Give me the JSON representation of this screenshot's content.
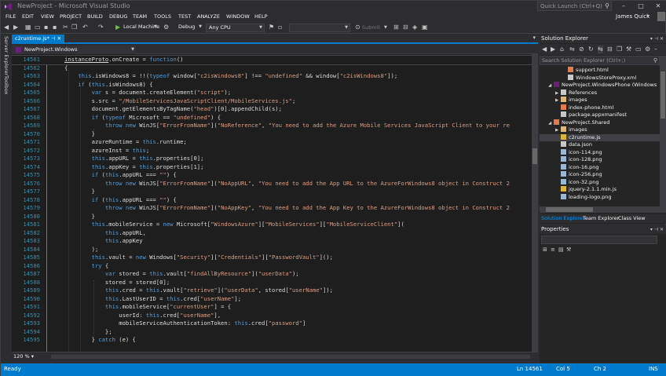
{
  "window": {
    "title": "NewProject - Microsoft Visual Studio"
  },
  "quick_launch": {
    "placeholder": "Quick Launch (Ctrl+Q)"
  },
  "user": {
    "name": "James Quick"
  },
  "menu": [
    "FILE",
    "EDIT",
    "VIEW",
    "PROJECT",
    "BUILD",
    "DEBUG",
    "TEAM",
    "TOOLS",
    "TEST",
    "ANALYZE",
    "WINDOW",
    "HELP"
  ],
  "toolbar": {
    "run_target": "Local Machine",
    "configuration": "Debug",
    "platform": "Any CPU",
    "submit_label": "Submit"
  },
  "left_rail": {
    "server_explorer": "Server Explorer",
    "toolbox": "Toolbox"
  },
  "editor": {
    "tab_label": "c2runtime.js*",
    "nav_scope": "NewProject.Windows",
    "zoom": "120 %",
    "lines": [
      {
        "num": "14561",
        "tokens": [
          {
            "t": "instanceProto",
            "c": "hl"
          },
          {
            "t": ".onCreate = ",
            "c": ""
          },
          {
            "t": "function",
            "c": "k"
          },
          {
            "t": "()",
            "c": ""
          }
        ]
      },
      {
        "num": "14562",
        "tokens": [
          {
            "t": "{",
            "c": ""
          }
        ]
      },
      {
        "num": "14563",
        "tokens": [
          {
            "t": "    ",
            "c": ""
          },
          {
            "t": "this",
            "c": "k"
          },
          {
            "t": ".isWindows8 = !!(",
            "c": ""
          },
          {
            "t": "typeof",
            "c": "k"
          },
          {
            "t": " window[",
            "c": ""
          },
          {
            "t": "\"c2isWindows8\"",
            "c": "s"
          },
          {
            "t": "] !== ",
            "c": ""
          },
          {
            "t": "\"undefined\"",
            "c": "s"
          },
          {
            "t": " && window[",
            "c": ""
          },
          {
            "t": "\"c2isWindows8\"",
            "c": "s"
          },
          {
            "t": "]);",
            "c": ""
          }
        ]
      },
      {
        "num": "14564",
        "tokens": [
          {
            "t": "    ",
            "c": ""
          },
          {
            "t": "if",
            "c": "k"
          },
          {
            "t": " (",
            "c": ""
          },
          {
            "t": "this",
            "c": "k"
          },
          {
            "t": ".isWindows8) {",
            "c": ""
          }
        ]
      },
      {
        "num": "14565",
        "tokens": [
          {
            "t": "        ",
            "c": ""
          },
          {
            "t": "var",
            "c": "k"
          },
          {
            "t": " s = document.createElement(",
            "c": ""
          },
          {
            "t": "\"script\"",
            "c": "s"
          },
          {
            "t": ");",
            "c": ""
          }
        ]
      },
      {
        "num": "14566",
        "tokens": [
          {
            "t": "        s.src = ",
            "c": ""
          },
          {
            "t": "\"/MobileServicesJavaScriptClient/MobileServices.js\"",
            "c": "s"
          },
          {
            "t": ";",
            "c": ""
          }
        ]
      },
      {
        "num": "14567",
        "tokens": [
          {
            "t": "        document.getElementsByTagName(",
            "c": ""
          },
          {
            "t": "\"head\"",
            "c": "s"
          },
          {
            "t": ")[0].appendChild(s);",
            "c": ""
          }
        ]
      },
      {
        "num": "14568",
        "tokens": [
          {
            "t": "        ",
            "c": ""
          },
          {
            "t": "if",
            "c": "k"
          },
          {
            "t": " (",
            "c": ""
          },
          {
            "t": "typeof",
            "c": "k"
          },
          {
            "t": " Microsoft == ",
            "c": ""
          },
          {
            "t": "\"undefined\"",
            "c": "s"
          },
          {
            "t": ") {",
            "c": ""
          }
        ]
      },
      {
        "num": "14569",
        "tokens": [
          {
            "t": "            ",
            "c": ""
          },
          {
            "t": "throw new",
            "c": "k"
          },
          {
            "t": " WinJS[",
            "c": ""
          },
          {
            "t": "\"ErrorFromName\"",
            "c": "s"
          },
          {
            "t": "](",
            "c": ""
          },
          {
            "t": "\"NoReference\"",
            "c": "s"
          },
          {
            "t": ", ",
            "c": ""
          },
          {
            "t": "\"You need to add the Azure Mobile Services JavaScript Client to your re",
            "c": "s"
          }
        ]
      },
      {
        "num": "14570",
        "tokens": [
          {
            "t": "        }",
            "c": ""
          }
        ]
      },
      {
        "num": "14571",
        "tokens": [
          {
            "t": "        azureRuntime = ",
            "c": ""
          },
          {
            "t": "this",
            "c": "k"
          },
          {
            "t": ".runtime;",
            "c": ""
          }
        ]
      },
      {
        "num": "14572",
        "tokens": [
          {
            "t": "        azureInst = ",
            "c": ""
          },
          {
            "t": "this",
            "c": "k"
          },
          {
            "t": ";",
            "c": ""
          }
        ]
      },
      {
        "num": "14573",
        "tokens": [
          {
            "t": "        ",
            "c": ""
          },
          {
            "t": "this",
            "c": "k"
          },
          {
            "t": ".appURL = ",
            "c": ""
          },
          {
            "t": "this",
            "c": "k"
          },
          {
            "t": ".properties[0];",
            "c": ""
          }
        ]
      },
      {
        "num": "14574",
        "tokens": [
          {
            "t": "        ",
            "c": ""
          },
          {
            "t": "this",
            "c": "k"
          },
          {
            "t": ".appKey = ",
            "c": ""
          },
          {
            "t": "this",
            "c": "k"
          },
          {
            "t": ".properties[1];",
            "c": ""
          }
        ]
      },
      {
        "num": "14575",
        "tokens": [
          {
            "t": "        ",
            "c": ""
          },
          {
            "t": "if",
            "c": "k"
          },
          {
            "t": " (",
            "c": ""
          },
          {
            "t": "this",
            "c": "k"
          },
          {
            "t": ".appURL === ",
            "c": ""
          },
          {
            "t": "\"\"",
            "c": "s"
          },
          {
            "t": ") {",
            "c": ""
          }
        ]
      },
      {
        "num": "14576",
        "tokens": [
          {
            "t": "            ",
            "c": ""
          },
          {
            "t": "throw new",
            "c": "k"
          },
          {
            "t": " WinJS[",
            "c": ""
          },
          {
            "t": "\"ErrorFromName\"",
            "c": "s"
          },
          {
            "t": "](",
            "c": ""
          },
          {
            "t": "\"NoAppURL\"",
            "c": "s"
          },
          {
            "t": ", ",
            "c": ""
          },
          {
            "t": "\"You need to add the App URL to the AzureForWindows8 object in Construct 2",
            "c": "s"
          }
        ]
      },
      {
        "num": "14577",
        "tokens": [
          {
            "t": "        }",
            "c": ""
          }
        ]
      },
      {
        "num": "14578",
        "tokens": [
          {
            "t": "        ",
            "c": ""
          },
          {
            "t": "if",
            "c": "k"
          },
          {
            "t": " (",
            "c": ""
          },
          {
            "t": "this",
            "c": "k"
          },
          {
            "t": ".appURL === ",
            "c": ""
          },
          {
            "t": "\"\"",
            "c": "s"
          },
          {
            "t": ") {",
            "c": ""
          }
        ]
      },
      {
        "num": "14579",
        "tokens": [
          {
            "t": "            ",
            "c": ""
          },
          {
            "t": "throw new",
            "c": "k"
          },
          {
            "t": " WinJS[",
            "c": ""
          },
          {
            "t": "\"ErrorFromName\"",
            "c": "s"
          },
          {
            "t": "](",
            "c": ""
          },
          {
            "t": "\"NoAppKey\"",
            "c": "s"
          },
          {
            "t": ", ",
            "c": ""
          },
          {
            "t": "\"You need to add the App Key to the AzureForWindows8 object in Construct 2",
            "c": "s"
          }
        ]
      },
      {
        "num": "14580",
        "tokens": [
          {
            "t": "        }",
            "c": ""
          }
        ]
      },
      {
        "num": "14581",
        "tokens": [
          {
            "t": "        ",
            "c": ""
          },
          {
            "t": "this",
            "c": "k"
          },
          {
            "t": ".mobileService = ",
            "c": ""
          },
          {
            "t": "new",
            "c": "k"
          },
          {
            "t": " Microsoft[",
            "c": ""
          },
          {
            "t": "\"WindowsAzure\"",
            "c": "s"
          },
          {
            "t": "][",
            "c": ""
          },
          {
            "t": "\"MobileServices\"",
            "c": "s"
          },
          {
            "t": "][",
            "c": ""
          },
          {
            "t": "\"MobileServiceClient\"",
            "c": "s"
          },
          {
            "t": "](",
            "c": ""
          }
        ]
      },
      {
        "num": "14582",
        "tokens": [
          {
            "t": "            ",
            "c": ""
          },
          {
            "t": "this",
            "c": "k"
          },
          {
            "t": ".appURL,",
            "c": ""
          }
        ]
      },
      {
        "num": "14583",
        "tokens": [
          {
            "t": "            ",
            "c": ""
          },
          {
            "t": "this",
            "c": "k"
          },
          {
            "t": ".appKey",
            "c": ""
          }
        ]
      },
      {
        "num": "14584",
        "tokens": [
          {
            "t": "        );",
            "c": ""
          }
        ]
      },
      {
        "num": "14585",
        "tokens": [
          {
            "t": "        ",
            "c": ""
          },
          {
            "t": "this",
            "c": "k"
          },
          {
            "t": ".vault = ",
            "c": ""
          },
          {
            "t": "new",
            "c": "k"
          },
          {
            "t": " Windows[",
            "c": ""
          },
          {
            "t": "\"Security\"",
            "c": "s"
          },
          {
            "t": "][",
            "c": ""
          },
          {
            "t": "\"Credentials\"",
            "c": "s"
          },
          {
            "t": "][",
            "c": ""
          },
          {
            "t": "\"PasswordVault\"",
            "c": "s"
          },
          {
            "t": "]();",
            "c": ""
          }
        ]
      },
      {
        "num": "14586",
        "tokens": [
          {
            "t": "        ",
            "c": ""
          },
          {
            "t": "try",
            "c": "k"
          },
          {
            "t": " {",
            "c": ""
          }
        ]
      },
      {
        "num": "14587",
        "tokens": [
          {
            "t": "            ",
            "c": ""
          },
          {
            "t": "var",
            "c": "k"
          },
          {
            "t": " stored = ",
            "c": ""
          },
          {
            "t": "this",
            "c": "k"
          },
          {
            "t": ".vault[",
            "c": ""
          },
          {
            "t": "\"findAllByResource\"",
            "c": "s"
          },
          {
            "t": "](",
            "c": ""
          },
          {
            "t": "\"userData\"",
            "c": "s"
          },
          {
            "t": ");",
            "c": ""
          }
        ]
      },
      {
        "num": "14588",
        "tokens": [
          {
            "t": "            stored = stored[0];",
            "c": ""
          }
        ]
      },
      {
        "num": "14589",
        "tokens": [
          {
            "t": "            ",
            "c": ""
          },
          {
            "t": "this",
            "c": "k"
          },
          {
            "t": ".cred = ",
            "c": ""
          },
          {
            "t": "this",
            "c": "k"
          },
          {
            "t": ".vault[",
            "c": ""
          },
          {
            "t": "\"retrieve\"",
            "c": "s"
          },
          {
            "t": "](",
            "c": ""
          },
          {
            "t": "\"userData\"",
            "c": "s"
          },
          {
            "t": ", stored[",
            "c": ""
          },
          {
            "t": "\"userName\"",
            "c": "s"
          },
          {
            "t": "]);",
            "c": ""
          }
        ]
      },
      {
        "num": "14590",
        "tokens": [
          {
            "t": "            ",
            "c": ""
          },
          {
            "t": "this",
            "c": "k"
          },
          {
            "t": ".LastUserID = ",
            "c": ""
          },
          {
            "t": "this",
            "c": "k"
          },
          {
            "t": ".cred[",
            "c": ""
          },
          {
            "t": "\"userName\"",
            "c": "s"
          },
          {
            "t": "];",
            "c": ""
          }
        ]
      },
      {
        "num": "14591",
        "tokens": [
          {
            "t": "            ",
            "c": ""
          },
          {
            "t": "this",
            "c": "k"
          },
          {
            "t": ".mobileService[",
            "c": ""
          },
          {
            "t": "\"currentUser\"",
            "c": "s"
          },
          {
            "t": "] = {",
            "c": ""
          }
        ]
      },
      {
        "num": "14592",
        "tokens": [
          {
            "t": "                userId: ",
            "c": ""
          },
          {
            "t": "this",
            "c": "k"
          },
          {
            "t": ".cred[",
            "c": ""
          },
          {
            "t": "\"userName\"",
            "c": "s"
          },
          {
            "t": "],",
            "c": ""
          }
        ]
      },
      {
        "num": "14593",
        "tokens": [
          {
            "t": "                mobileServiceAuthenticationToken: ",
            "c": ""
          },
          {
            "t": "this",
            "c": "k"
          },
          {
            "t": ".cred[",
            "c": ""
          },
          {
            "t": "\"password\"",
            "c": "s"
          },
          {
            "t": "]",
            "c": ""
          }
        ]
      },
      {
        "num": "14594",
        "tokens": [
          {
            "t": "            };",
            "c": ""
          }
        ]
      },
      {
        "num": "14595",
        "tokens": [
          {
            "t": "        } ",
            "c": ""
          },
          {
            "t": "catch",
            "c": "k"
          },
          {
            "t": " (e) {",
            "c": ""
          }
        ]
      }
    ]
  },
  "solution_explorer": {
    "title": "Solution Explorer",
    "search_placeholder": "Search Solution Explorer (Ctrl+;)",
    "items": [
      {
        "label": "support.html",
        "indent": 3,
        "icon": "html-file-icon",
        "arrow": ""
      },
      {
        "label": "WindowsStoreProxy.xml",
        "indent": 3,
        "icon": "xml-file-icon",
        "arrow": ""
      },
      {
        "label": "NewProject.WindowsPhone (Windows",
        "indent": 1,
        "icon": "phone-project-icon",
        "arrow": "▲"
      },
      {
        "label": "References",
        "indent": 2,
        "icon": "references-icon",
        "arrow": "▶"
      },
      {
        "label": "images",
        "indent": 2,
        "icon": "folder-icon",
        "arrow": "▶"
      },
      {
        "label": "index-phone.html",
        "indent": 2,
        "icon": "html-file-icon",
        "arrow": ""
      },
      {
        "label": "package.appxmanifest",
        "indent": 2,
        "icon": "manifest-file-icon",
        "arrow": ""
      },
      {
        "label": "NewProject.Shared",
        "indent": 1,
        "icon": "shared-project-icon",
        "arrow": "▲"
      },
      {
        "label": "images",
        "indent": 2,
        "icon": "folder-icon",
        "arrow": "▶"
      },
      {
        "label": "c2runtime.js",
        "indent": 2,
        "icon": "js-file-icon",
        "arrow": "",
        "selected": true
      },
      {
        "label": "data.json",
        "indent": 2,
        "icon": "json-file-icon",
        "arrow": ""
      },
      {
        "label": "icon-114.png",
        "indent": 2,
        "icon": "image-file-icon",
        "arrow": ""
      },
      {
        "label": "icon-128.png",
        "indent": 2,
        "icon": "image-file-icon",
        "arrow": ""
      },
      {
        "label": "icon-16.png",
        "indent": 2,
        "icon": "image-file-icon",
        "arrow": ""
      },
      {
        "label": "icon-256.png",
        "indent": 2,
        "icon": "image-file-icon",
        "arrow": ""
      },
      {
        "label": "icon-32.png",
        "indent": 2,
        "icon": "image-file-icon",
        "arrow": ""
      },
      {
        "label": "jquery-2.1.1.min.js",
        "indent": 2,
        "icon": "js-file-icon",
        "arrow": ""
      },
      {
        "label": "loading-logo.png",
        "indent": 2,
        "icon": "image-file-icon",
        "arrow": ""
      }
    ]
  },
  "bottom_tabs": [
    "Solution Explorer",
    "Team Explorer",
    "Class View"
  ],
  "properties": {
    "title": "Properties"
  },
  "status": {
    "ready": "Ready",
    "line": "Ln 14561",
    "col": "Col 5",
    "ch": "Ch 2",
    "mode": "INS"
  },
  "colors": {
    "accent": "#007acc",
    "keyword": "#569cd6",
    "string": "#d69d85",
    "line_number": "#2b91af",
    "editor_bg": "#1e1e1e"
  }
}
